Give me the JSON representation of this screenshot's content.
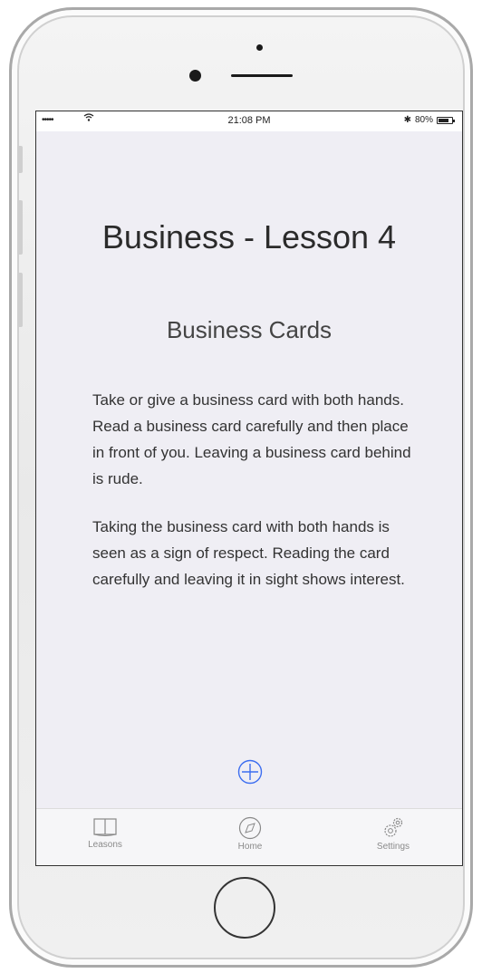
{
  "status_bar": {
    "signal": "•••••",
    "time": "21:08 PM",
    "bluetooth": "✱",
    "battery_percent": "80%",
    "battery_level": 0.8
  },
  "lesson": {
    "title": "Business - Lesson 4",
    "subtitle": "Business Cards",
    "paragraph1": "Take or give a business card with both hands. Read a business card carefully and then place in front of you. Leaving a business card behind is rude.",
    "paragraph2": "Taking the business card with both hands is seen as a sign of respect. Reading the card carefully and leaving it in sight shows interest."
  },
  "add_button": {
    "icon": "plus-circle-icon",
    "color": "#3d6ef0"
  },
  "tab_bar": {
    "tabs": [
      {
        "label": "Leasons",
        "icon": "book-icon"
      },
      {
        "label": "Home",
        "icon": "compass-icon"
      },
      {
        "label": "Settings",
        "icon": "gears-icon"
      }
    ]
  }
}
